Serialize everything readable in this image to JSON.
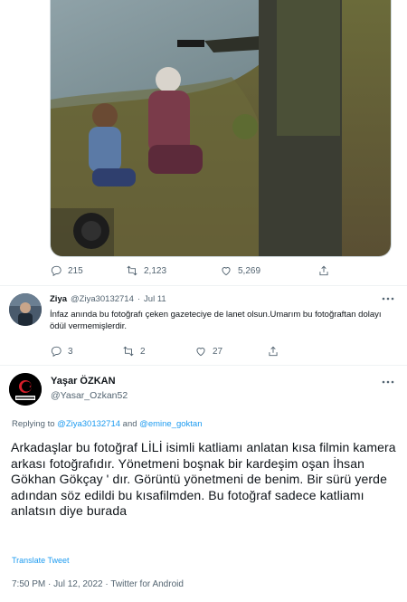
{
  "top_tweet": {
    "actions": {
      "replies": "215",
      "retweets": "2,123",
      "likes": "5,269"
    }
  },
  "reply_tweet": {
    "name": "Ziya",
    "handle": "@Ziya30132714",
    "separator": "·",
    "date": "Jul 11",
    "text": "İnfaz anında bu fotoğrafı çeken gazeteciye de lanet olsun.Umarım bu fotoğraftan dolayı ödül vermemişlerdir.",
    "actions": {
      "replies": "3",
      "retweets": "2",
      "likes": "27"
    }
  },
  "main_tweet": {
    "name": "Yaşar ÖZKAN",
    "handle": "@Yasar_Ozkan52",
    "replying_prefix": "Replying to",
    "replying_user1": "@Ziya30132714",
    "replying_and": "and",
    "replying_user2": "@emine_goktan",
    "text": "Arkadaşlar bu fotoğraf LİLİ isimli katliamı anlatan kısa filmin kamera arkası fotoğrafıdır. Yönetmeni boşnak bir kardeşim oşan İhsan Gökhan Gökçay ' dır. Görüntü yönetmeni de benim. Bir sürü yerde adından söz edildi bu kısafilmden. Bu fotoğraf sadece katliamı anlatsın diye burada",
    "translate": "Translate Tweet",
    "timestamp": "7:50 PM · Jul 12, 2022 · Twitter for Android"
  }
}
